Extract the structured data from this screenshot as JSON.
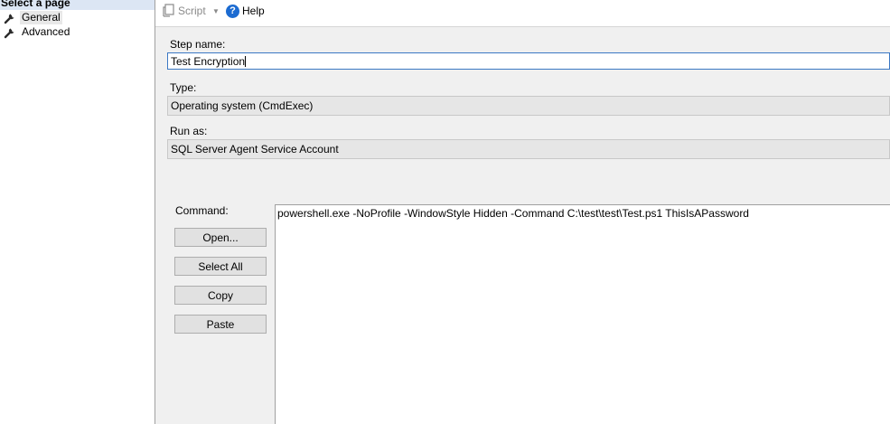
{
  "left_pane": {
    "header": "Select a page",
    "items": [
      {
        "label": "General",
        "icon": "wrench-icon",
        "selected": true
      },
      {
        "label": "Advanced",
        "icon": "wrench-icon",
        "selected": false
      }
    ]
  },
  "toolbar": {
    "script_label": "Script",
    "help_label": "Help"
  },
  "form": {
    "step_name_label": "Step name:",
    "step_name_value": "Test Encryption",
    "type_label": "Type:",
    "type_value": "Operating system (CmdExec)",
    "run_as_label": "Run as:",
    "run_as_value": "SQL Server Agent Service Account",
    "command_label": "Command:",
    "command_value": "powershell.exe -NoProfile -WindowStyle Hidden -Command C:\\test\\test\\Test.ps1 ThisIsAPassword"
  },
  "buttons": {
    "open": "Open...",
    "select_all": "Select All",
    "copy": "Copy",
    "paste": "Paste"
  },
  "colors": {
    "header_bg": "#dce6f4",
    "focus_border": "#3b78c4",
    "help_icon": "#1c6bd1"
  }
}
